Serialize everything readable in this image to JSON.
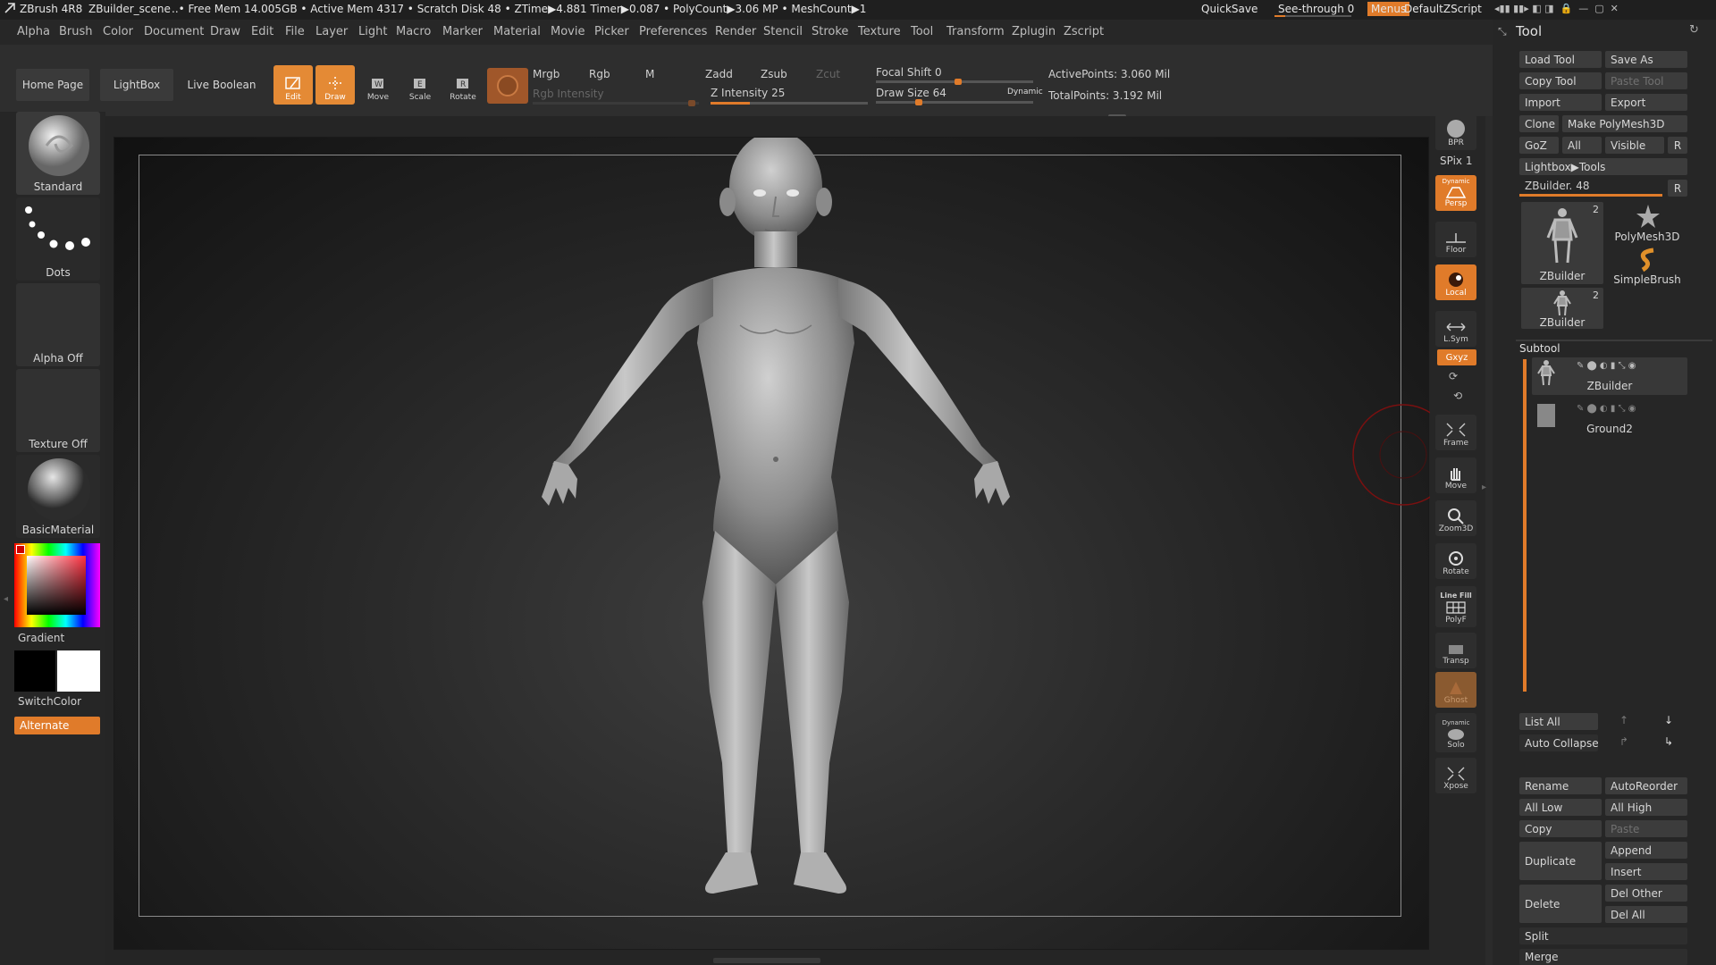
{
  "titlebar": {
    "app": "ZBrush 4R8",
    "scene": "ZBuilder_scene",
    "stats": "..• Free Mem 14.005GB • Active Mem 4317 • Scratch Disk 48 • ZTime▶4.881 Timer▶0.087 • PolyCount▶3.06 MP  • MeshCount▶1",
    "quicksave": "QuickSave",
    "see_through": "See-through  0",
    "menus": "Menus",
    "default_zscript": "DefaultZScript"
  },
  "menubar": [
    "Alpha",
    "Brush",
    "Color",
    "Document",
    "Draw",
    "Edit",
    "File",
    "Layer",
    "Light",
    "Macro",
    "Marker",
    "Material",
    "Movie",
    "Picker",
    "Preferences",
    "Render",
    "Stencil",
    "Stroke",
    "Texture",
    "Tool",
    "Transform",
    "Zplugin",
    "Zscript"
  ],
  "toolbar": {
    "home_page": "Home Page",
    "lightbox": "LightBox",
    "live_boolean": "Live Boolean",
    "edit": "Edit",
    "draw": "Draw",
    "move": "Move",
    "scale": "Scale",
    "rotate": "Rotate",
    "mrgb": "Mrgb",
    "rgb": "Rgb",
    "m": "M",
    "rgb_intensity": "Rgb Intensity",
    "zadd": "Zadd",
    "zsub": "Zsub",
    "zcut": "Zcut",
    "z_intensity": "Z Intensity 25",
    "z_intensity_value": 25,
    "focal_shift": "Focal Shift 0",
    "draw_size": "Draw Size 64",
    "dynamic": "Dynamic",
    "active_points": "ActivePoints: 3.060 Mil",
    "total_points": "TotalPoints: 3.192 Mil"
  },
  "left_shelf": {
    "brush": "Standard",
    "stroke": "Dots",
    "alpha": "Alpha Off",
    "texture": "Texture Off",
    "material": "BasicMaterial",
    "gradient": "Gradient",
    "switch_color": "SwitchColor",
    "alternate": "Alternate"
  },
  "right_shelf": {
    "bpr": "BPR",
    "spix": "SPix 1",
    "dynamic": "Dynamic",
    "persp": "Persp",
    "floor": "Floor",
    "local": "Local",
    "lsym": "L.Sym",
    "xyz": "Gxyz",
    "frame": "Frame",
    "move": "Move",
    "zoom3d": "Zoom3D",
    "rotate": "Rotate",
    "line_fill": "Line Fill",
    "polyf": "PolyF",
    "transp": "Transp",
    "ghost": "Ghost",
    "dynamic2": "Dynamic",
    "solo": "Solo",
    "xpose": "Xpose"
  },
  "tool_panel": {
    "title": "Tool",
    "load_tool": "Load Tool",
    "save_as": "Save As",
    "copy_tool": "Copy Tool",
    "paste_tool": "Paste Tool",
    "import": "Import",
    "export": "Export",
    "clone": "Clone",
    "make_polymesh": "Make PolyMesh3D",
    "goz": "GoZ",
    "all": "All",
    "visible": "Visible",
    "r": "R",
    "lightbox_tools": "Lightbox▶Tools",
    "zbuilder_slider": "ZBuilder. 48",
    "thumb1_label": "ZBuilder",
    "thumb1_count": "2",
    "polymesh3d": "PolyMesh3D",
    "simplebrush": "SimpleBrush",
    "thumb2_label": "ZBuilder",
    "thumb2_count": "2",
    "subtool_title": "Subtool",
    "subtools": [
      "ZBuilder",
      "Ground2"
    ],
    "list_all": "List All",
    "auto_collapse": "Auto Collapse",
    "rename": "Rename",
    "autoreorder": "AutoReorder",
    "all_low": "All Low",
    "all_high": "All High",
    "copy": "Copy",
    "paste": "Paste",
    "duplicate": "Duplicate",
    "append": "Append",
    "insert": "Insert",
    "delete": "Delete",
    "del_other": "Del Other",
    "del_all": "Del All",
    "split": "Split",
    "merge": "Merge"
  },
  "colors": {
    "accent": "#e07b2a",
    "bg": "#2b2b2b",
    "canvas": "#141414"
  }
}
